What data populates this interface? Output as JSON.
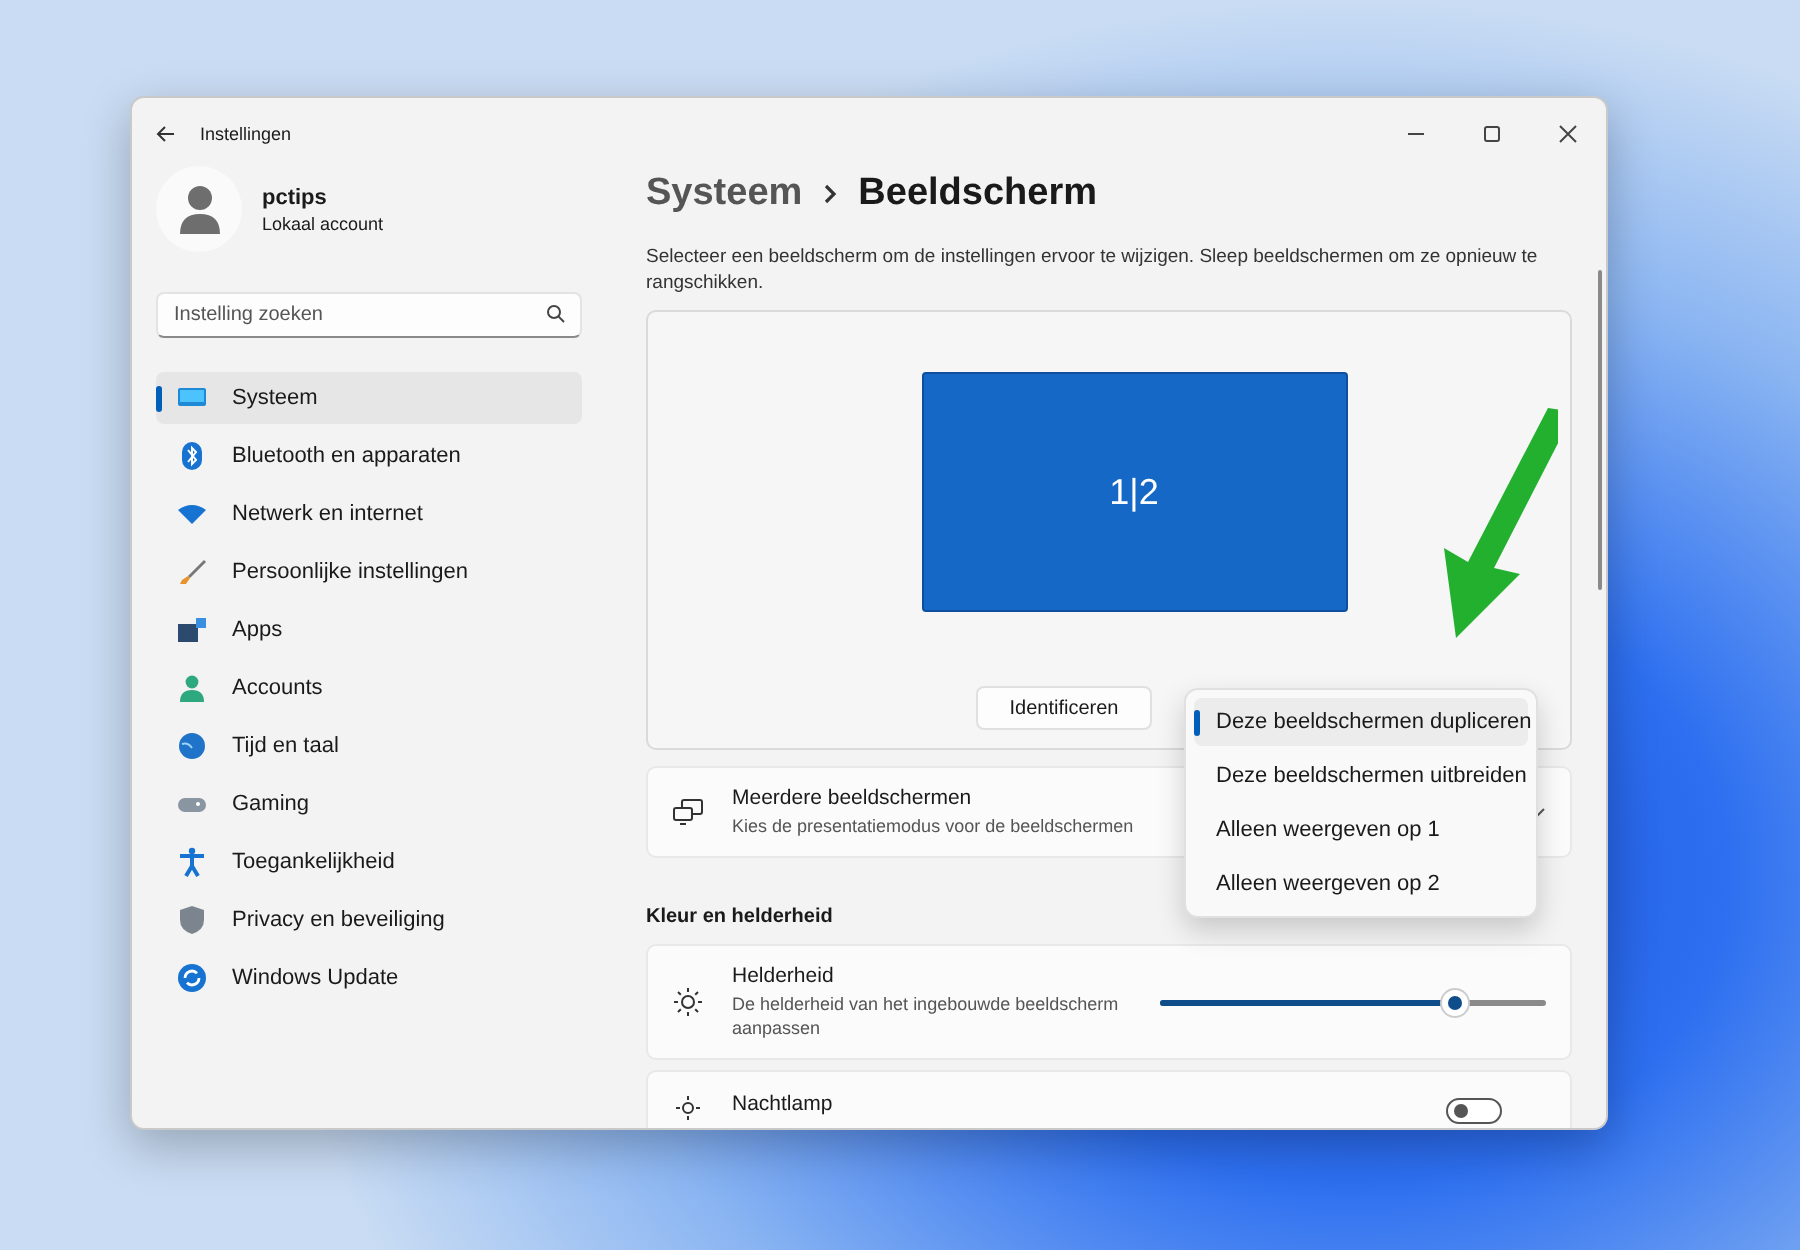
{
  "window": {
    "title": "Instellingen"
  },
  "account": {
    "name": "pctips",
    "type": "Lokaal account"
  },
  "search": {
    "placeholder": "Instelling zoeken"
  },
  "sidebar": {
    "items": [
      {
        "label": "Systeem",
        "kind": "monitor",
        "selected": true
      },
      {
        "label": "Bluetooth en apparaten",
        "kind": "bluetooth",
        "selected": false
      },
      {
        "label": "Netwerk en internet",
        "kind": "wifi",
        "selected": false
      },
      {
        "label": "Persoonlijke instellingen",
        "kind": "brush",
        "selected": false
      },
      {
        "label": "Apps",
        "kind": "apps",
        "selected": false
      },
      {
        "label": "Accounts",
        "kind": "person",
        "selected": false
      },
      {
        "label": "Tijd en taal",
        "kind": "globe",
        "selected": false
      },
      {
        "label": "Gaming",
        "kind": "gamepad",
        "selected": false
      },
      {
        "label": "Toegankelijkheid",
        "kind": "accessibility",
        "selected": false
      },
      {
        "label": "Privacy en beveiliging",
        "kind": "shield",
        "selected": false
      },
      {
        "label": "Windows Update",
        "kind": "update",
        "selected": false
      }
    ]
  },
  "breadcrumb": [
    "Systeem",
    "Beeldscherm"
  ],
  "description": "Selecteer een beeldscherm om de instellingen ervoor te wijzigen. Sleep beeldschermen om ze opnieuw te rangschikken.",
  "display_arrangement": {
    "monitor_label": "1|2",
    "identify_button": "Identificeren"
  },
  "multiple_displays": {
    "title": "Meerdere beeldschermen",
    "subtitle": "Kies de presentatiemodus voor de beeldschermen"
  },
  "dropdown_menu": {
    "items": [
      {
        "label": "Deze beeldschermen dupliceren",
        "selected": true
      },
      {
        "label": "Deze beeldschermen uitbreiden",
        "selected": false
      },
      {
        "label": "Alleen weergeven op 1",
        "selected": false
      },
      {
        "label": "Alleen weergeven op 2",
        "selected": false
      }
    ]
  },
  "section_heading": "Kleur en helderheid",
  "brightness": {
    "title": "Helderheid",
    "subtitle": "De helderheid van het ingebouwde beeldscherm aanpassen",
    "level": 0.78
  },
  "night_light": {
    "title": "Nachtlamp",
    "on": false
  }
}
